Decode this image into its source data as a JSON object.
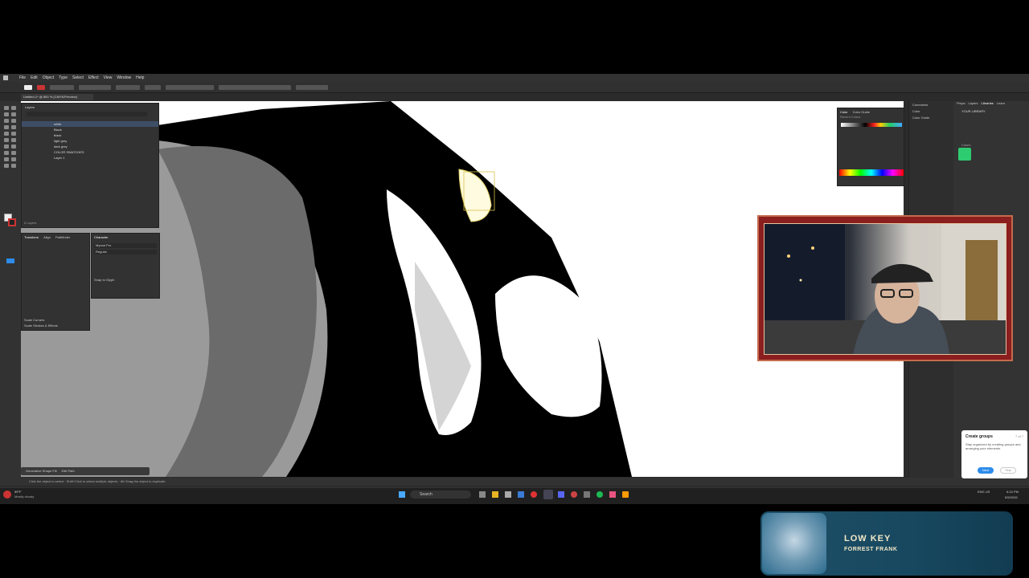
{
  "app": {
    "menu": [
      "File",
      "Edit",
      "Object",
      "Type",
      "Select",
      "Effect",
      "View",
      "Window",
      "Help"
    ],
    "doc_tab": "Untitled-1* @ 800 % (CMYK/Preview)",
    "status_hint": "Click the object to select · Shift+Click to select multiple objects · Alt+Drag the object to duplicate"
  },
  "layers": {
    "title": "Layers",
    "rows": [
      "white",
      "Black",
      "black",
      "light grey",
      "dark grey",
      "COLOR SWATCHES",
      "Layer 1"
    ],
    "footer": "6 Layers"
  },
  "transform": {
    "tabs": [
      "Transform",
      "Align",
      "Pathfinder"
    ],
    "checkboxes": [
      "Scale Corners",
      "Scale Strokes & Effects"
    ]
  },
  "character": {
    "title": "Character",
    "font": "Myriad Pro",
    "style": "Regular",
    "snap_label": "Snap to Glyph"
  },
  "color_panel": {
    "tabs": [
      "Color",
      "Color Guide"
    ],
    "recent_label": "Recent Colors"
  },
  "right_dock": {
    "items": [
      "Comments",
      "Color",
      "Color Guide"
    ]
  },
  "libraries": {
    "tabs": [
      "Props",
      "Layers",
      "Libraries",
      "Learn"
    ],
    "title": "YOUR LIBRARY",
    "colors_label": "Colors",
    "swatch": "#2ecc71"
  },
  "bottom_bar": {
    "items": [
      "Generative Shape Fill",
      "Edit Path"
    ]
  },
  "create_groups": {
    "title": "Create groups",
    "step": "7 of 7",
    "body": "Stay organized by creating groups and arranging your elements.",
    "next": "Next",
    "skip": "Skip"
  },
  "taskbar": {
    "weather_temp": "59°F",
    "weather_text": "Mostly cloudy",
    "search": "Search",
    "lang": "ENG US",
    "time": "6:24 PM",
    "date": "5/5/2026"
  },
  "music": {
    "title": "LOW KEY",
    "artist": "FORREST FRANK"
  },
  "colors": {
    "accent": "#2d8ceb",
    "webcam_frame": "#8b1e1e",
    "music_bg": "#1e4f68"
  }
}
